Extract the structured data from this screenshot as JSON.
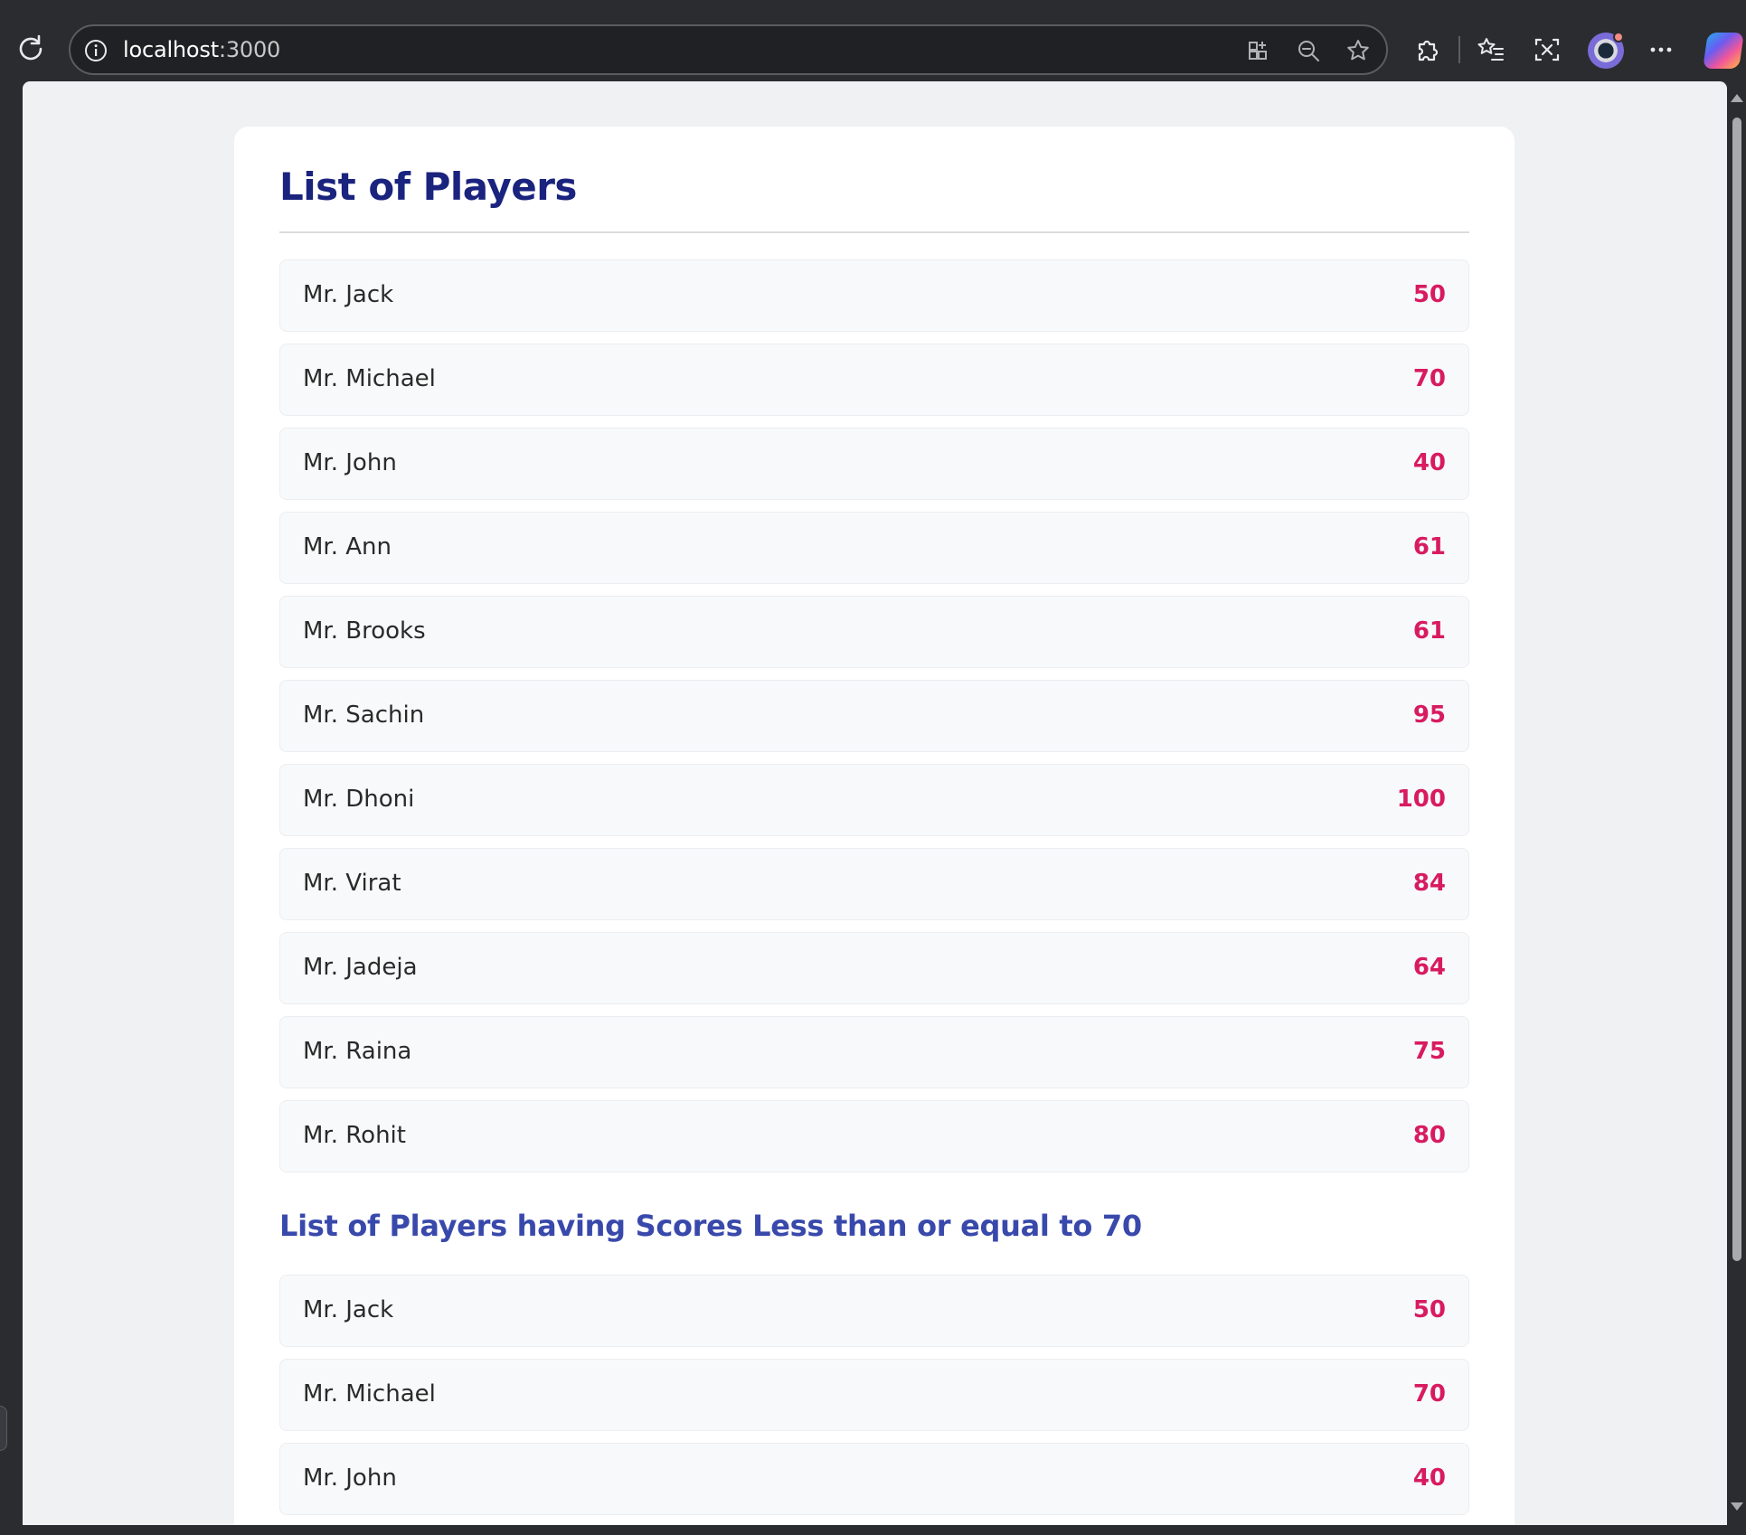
{
  "browser": {
    "url_host": "localhost",
    "url_port": ":3000"
  },
  "page": {
    "title": "List of Players",
    "filtered_title": "List of Players having Scores Less than or equal to 70",
    "players": [
      {
        "name": "Mr. Jack",
        "score": "50"
      },
      {
        "name": "Mr. Michael",
        "score": "70"
      },
      {
        "name": "Mr. John",
        "score": "40"
      },
      {
        "name": "Mr. Ann",
        "score": "61"
      },
      {
        "name": "Mr. Brooks",
        "score": "61"
      },
      {
        "name": "Mr. Sachin",
        "score": "95"
      },
      {
        "name": "Mr. Dhoni",
        "score": "100"
      },
      {
        "name": "Mr. Virat",
        "score": "84"
      },
      {
        "name": "Mr. Jadeja",
        "score": "64"
      },
      {
        "name": "Mr. Raina",
        "score": "75"
      },
      {
        "name": "Mr. Rohit",
        "score": "80"
      }
    ],
    "filtered_players": [
      {
        "name": "Mr. Jack",
        "score": "50"
      },
      {
        "name": "Mr. Michael",
        "score": "70"
      },
      {
        "name": "Mr. John",
        "score": "40"
      }
    ]
  },
  "colors": {
    "title": "#1a237e",
    "subtitle": "#3949ab",
    "score": "#d81b60",
    "row_background": "#f8f9fa",
    "page_background": "#f0f1f3"
  }
}
